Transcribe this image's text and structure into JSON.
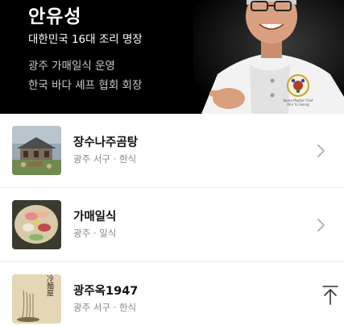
{
  "hero": {
    "name": "안유성",
    "title": "대한민국 16대 조리 명장",
    "line1": "광주 가매일식 운영",
    "line2": "한국 바다 셰프 협회 회장",
    "badge_text_1": "Korea Master Chef",
    "badge_text_2": "Ahn Yu Seong"
  },
  "restaurants": [
    {
      "name": "장수나주곰탕",
      "meta": "광주 서구 · 한식",
      "thumb_icon": "building-photo-icon"
    },
    {
      "name": "가매일식",
      "meta": "광주 · 일식",
      "thumb_icon": "sashimi-photo-icon"
    },
    {
      "name": "광주옥1947",
      "meta": "광주 서구 · 한식",
      "thumb_icon": "noodle-sign-photo-icon",
      "thumb_caption": "冷麵屋"
    }
  ],
  "colors": {
    "hero_bg": "#000000",
    "chevron": "#b5b5b5",
    "divider": "#ececec"
  }
}
